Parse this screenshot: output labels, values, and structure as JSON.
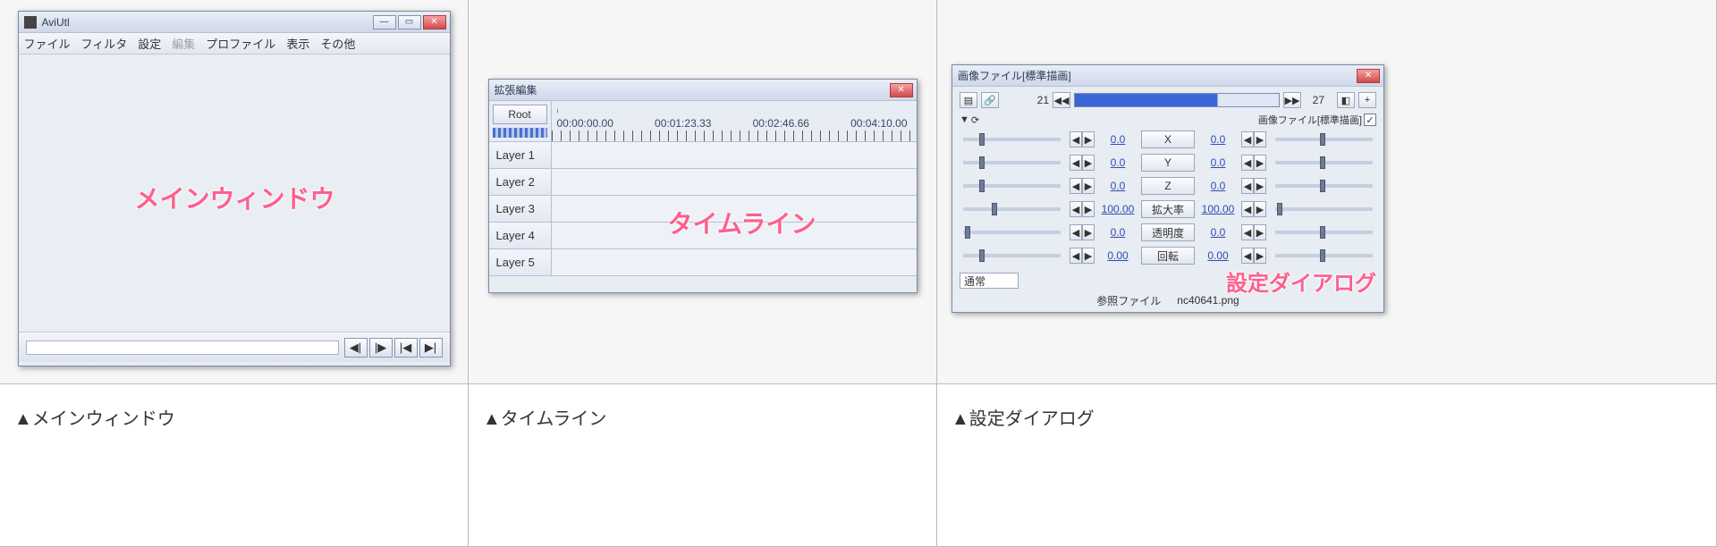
{
  "captions": {
    "main": "▲メインウィンドウ",
    "timeline": "▲タイムライン",
    "settings": "▲設定ダイアログ"
  },
  "overlays": {
    "main": "メインウィンドウ",
    "timeline": "タイムライン",
    "settings": "設定ダイアログ"
  },
  "mainWindow": {
    "title": "AviUtl",
    "menu": {
      "file": "ファイル",
      "filter": "フィルタ",
      "settings": "設定",
      "edit": "編集",
      "profile": "プロファイル",
      "view": "表示",
      "other": "その他"
    }
  },
  "timelineWindow": {
    "title": "拡張編集",
    "rootButton": "Root",
    "cursorIcon": "ᵢ",
    "timecodes": [
      "00:00:00.00",
      "00:01:23.33",
      "00:02:46.66",
      "00:04:10.00"
    ],
    "layers": [
      "Layer 1",
      "Layer 2",
      "Layer 3",
      "Layer 4",
      "Layer 5"
    ]
  },
  "settingsDialog": {
    "title": "画像ファイル[標準描画]",
    "frameStart": "21",
    "frameEnd": "27",
    "subTypeLabel": "画像ファイル[標準描画]",
    "clockIcon": "⟳",
    "params": [
      {
        "name": "X",
        "left": "0.0",
        "right": "0.0",
        "lthumb": 18,
        "rthumb": 50
      },
      {
        "name": "Y",
        "left": "0.0",
        "right": "0.0",
        "lthumb": 18,
        "rthumb": 50
      },
      {
        "name": "Z",
        "left": "0.0",
        "right": "0.0",
        "lthumb": 18,
        "rthumb": 50
      },
      {
        "name": "拡大率",
        "left": "100.00",
        "right": "100.00",
        "lthumb": 32,
        "rthumb": 2
      },
      {
        "name": "透明度",
        "left": "0.0",
        "right": "0.0",
        "lthumb": 2,
        "rthumb": 50
      },
      {
        "name": "回転",
        "left": "0.00",
        "right": "0.00",
        "lthumb": 18,
        "rthumb": 50
      }
    ],
    "blendMode": "通常",
    "refFileLabel": "参照ファイル",
    "refFileName": "nc40641.png"
  }
}
